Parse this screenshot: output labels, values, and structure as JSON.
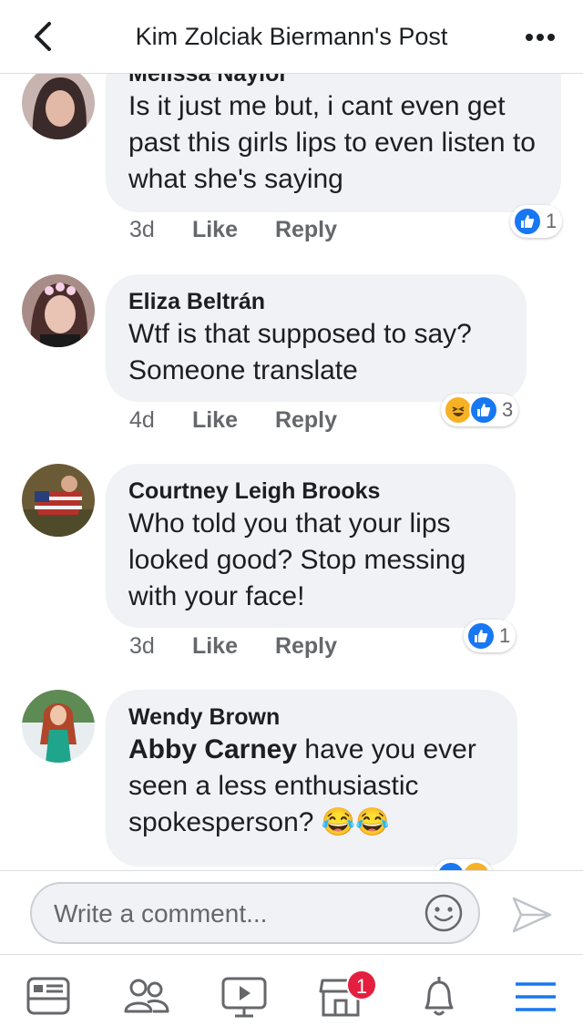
{
  "header": {
    "title": "Kim Zolciak Biermann's Post"
  },
  "comments": [
    {
      "author": "Melissa Naylor",
      "text": "Is it just me but, i cant even get past this girls lips to even listen to what she's saying",
      "time": "3d",
      "like_label": "Like",
      "reply_label": "Reply",
      "reaction_count": "1"
    },
    {
      "author": "Eliza Beltrán",
      "text": "Wtf is that supposed to say? Someone translate",
      "time": "4d",
      "like_label": "Like",
      "reply_label": "Reply",
      "reaction_count": "3"
    },
    {
      "author": "Courtney Leigh Brooks",
      "text": "Who told you that your lips looked good? Stop messing with your face!",
      "time": "3d",
      "like_label": "Like",
      "reply_label": "Reply",
      "reaction_count": "1"
    },
    {
      "author": "Wendy Brown",
      "mention": "Abby Carney",
      "text": " have you ever seen a less enthusiastic spokesperson? 😂😂"
    }
  ],
  "composer": {
    "placeholder": "Write a comment..."
  },
  "tabbar": {
    "marketplace_badge": "1"
  },
  "colors": {
    "accent": "#1877f2",
    "bubble": "#f0f2f5",
    "badge": "#e41e3f",
    "meta": "#65676b"
  }
}
